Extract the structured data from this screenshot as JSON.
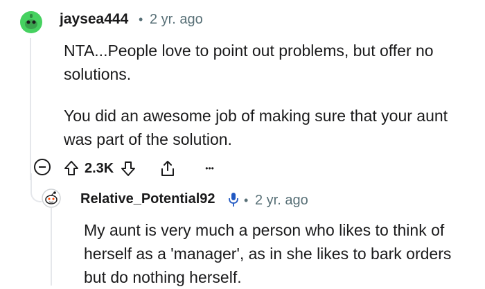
{
  "comment": {
    "username": "jaysea444",
    "separator": "•",
    "timestamp": "2 yr. ago",
    "paragraph1": "NTA...People love to point out problems, but offer no solutions.",
    "paragraph2": "You did an awesome job of making sure that your aunt was part of the solution.",
    "actions": {
      "vote_count": "2.3K",
      "more": "•••"
    }
  },
  "reply": {
    "username": "Relative_Potential92",
    "separator": "•",
    "timestamp": "2 yr. ago",
    "text": "My aunt is very much a person who likes to think of herself as a 'manager', as in she likes to bark orders but do nothing herself."
  },
  "colors": {
    "avatar_green": "#46d160",
    "meta_gray": "#576f76",
    "thread_line": "#e5e7eb",
    "text": "#1a1a1b",
    "mic_blue": "#2158c2"
  },
  "icons": [
    "collapse-icon",
    "upvote-icon",
    "downvote-icon",
    "share-icon",
    "more-icon",
    "microphone-icon"
  ]
}
